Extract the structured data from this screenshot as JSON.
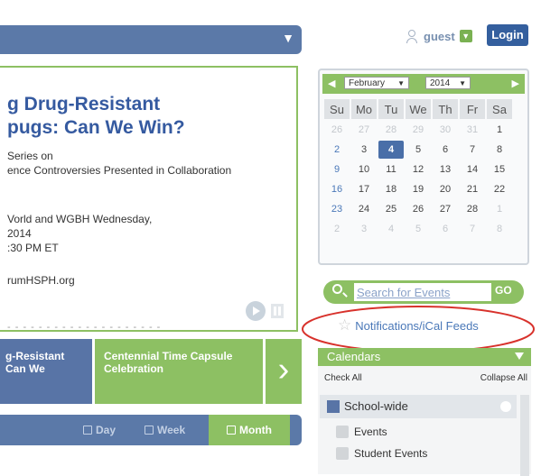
{
  "header": {
    "guest_label": "guest",
    "login_label": "Login"
  },
  "feature": {
    "title_line1": "g Drug-Resistant",
    "title_line2": "pugs: Can We Win?",
    "lines": [
      "Series on",
      "ence Controversies Presented in Collaboration",
      "",
      "Vorld and WGBH Wednesday,",
      "2014",
      ":30 PM ET",
      "",
      "rumHSPH.org"
    ]
  },
  "carousel": {
    "item1": {
      "line1": "g-Resistant",
      "line2": "Can We"
    },
    "item2": {
      "line1": "Centennial Time Capsule",
      "line2": "Celebration"
    },
    "next_glyph": "›"
  },
  "view_tabs": {
    "day": "Day",
    "week": "Week",
    "month": "Month"
  },
  "calendar": {
    "month": "February",
    "year": "2014",
    "weekdays": [
      "Su",
      "Mo",
      "Tu",
      "We",
      "Th",
      "Fr",
      "Sa"
    ],
    "weeks": [
      [
        "26",
        "27",
        "28",
        "29",
        "30",
        "31",
        "1"
      ],
      [
        "2",
        "3",
        "4",
        "5",
        "6",
        "7",
        "8"
      ],
      [
        "9",
        "10",
        "11",
        "12",
        "13",
        "14",
        "15"
      ],
      [
        "16",
        "17",
        "18",
        "19",
        "20",
        "21",
        "22"
      ],
      [
        "23",
        "24",
        "25",
        "26",
        "27",
        "28",
        "1"
      ],
      [
        "2",
        "3",
        "4",
        "5",
        "6",
        "7",
        "8"
      ]
    ],
    "selected_day": "4"
  },
  "search": {
    "placeholder": "Search for Events",
    "go_label": "GO"
  },
  "notifications_label": "Notifications/iCal Feeds",
  "calendars_panel": {
    "title": "Calendars",
    "check_all": "Check All",
    "collapse_all": "Collapse All",
    "group_label": "School-wide",
    "items": [
      "Events",
      "Student Events"
    ]
  },
  "colors": {
    "accent_green": "#8dc063",
    "nav_blue": "#5b79a8",
    "highlight_red": "#d8322c"
  }
}
